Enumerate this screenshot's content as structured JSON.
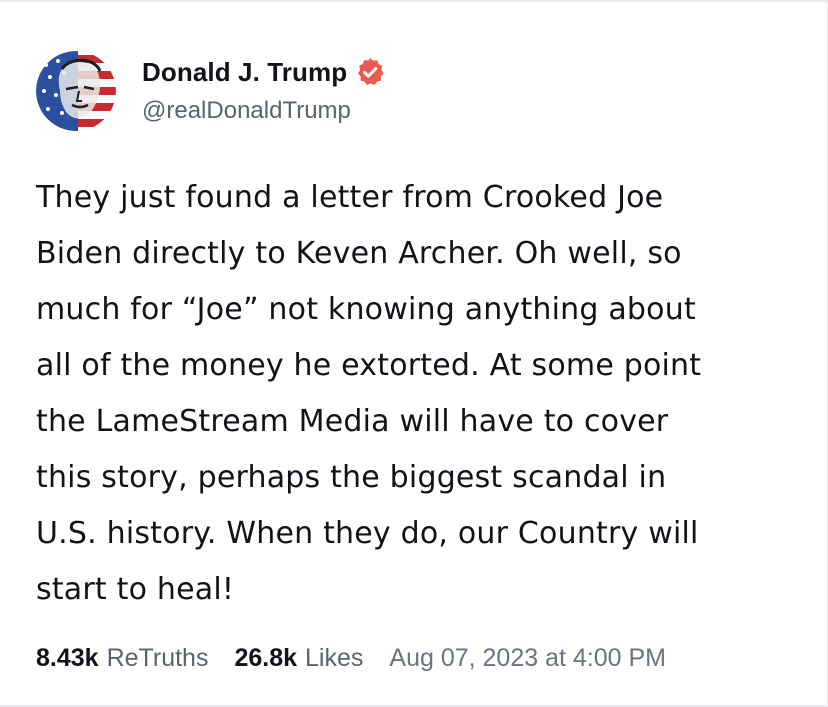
{
  "author": {
    "display_name": "Donald J. Trump",
    "handle": "@realDonaldTrump",
    "verified_icon": "verified-badge-icon",
    "verified_color": "#ee5a4f"
  },
  "post": {
    "lines": [
      "They just found a letter from Crooked Joe",
      "Biden directly to Keven Archer. Oh well, so",
      "much for “Joe” not knowing anything about",
      "all of the money he extorted. At some point",
      "the LameStream Media will have to cover",
      "this story, perhaps the biggest scandal in",
      "U.S. history. When they do, our Country will",
      "start to heal!"
    ]
  },
  "stats": {
    "retruths_count": "8.43k",
    "retruths_label": "ReTruths",
    "likes_count": "26.8k",
    "likes_label": "Likes",
    "timestamp": "Aug 07, 2023 at 4:00 PM"
  }
}
